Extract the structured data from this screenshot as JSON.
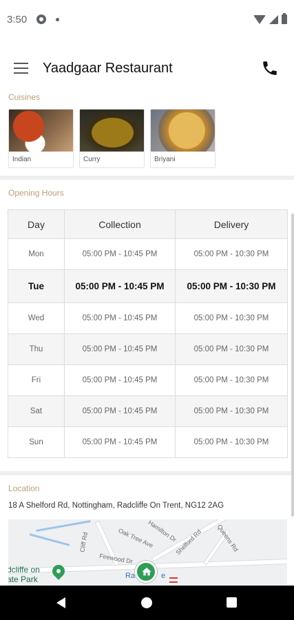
{
  "status_bar": {
    "time": "3:50"
  },
  "app_bar": {
    "title": "Yaadgaar Restaurant"
  },
  "cuisines": {
    "label": "Cuisines",
    "items": [
      {
        "name": "Indian"
      },
      {
        "name": "Curry"
      },
      {
        "name": "Briyani"
      }
    ]
  },
  "opening_hours": {
    "label": "Opening Hours",
    "headers": [
      "Day",
      "Collection",
      "Delivery"
    ],
    "rows": [
      {
        "day": "Mon",
        "collection": "05:00 PM - 10:45 PM",
        "delivery": "05:00 PM - 10:30 PM"
      },
      {
        "day": "Tue",
        "collection": "05:00 PM - 10:45 PM",
        "delivery": "05:00 PM - 10:30 PM",
        "today": true
      },
      {
        "day": "Wed",
        "collection": "05:00 PM - 10:45 PM",
        "delivery": "05:00 PM - 10:30 PM"
      },
      {
        "day": "Thu",
        "collection": "05:00 PM - 10:45 PM",
        "delivery": "05:00 PM - 10:30 PM"
      },
      {
        "day": "Fri",
        "collection": "05:00 PM - 10:45 PM",
        "delivery": "05:00 PM - 10:30 PM"
      },
      {
        "day": "Sat",
        "collection": "05:00 PM - 10:45 PM",
        "delivery": "05:00 PM - 10:30 PM"
      },
      {
        "day": "Sun",
        "collection": "05:00 PM - 10:45 PM",
        "delivery": "05:00 PM - 10:30 PM"
      }
    ]
  },
  "location": {
    "label": "Location",
    "address": "18 A Shelford Rd, Nottingham, Radcliffe On Trent, NG12 2AG",
    "map": {
      "street_labels": [
        "Oak Tree Ave",
        "Hamilton Dr",
        "Shelford Rd",
        "Queens Rd",
        "Firewood Dr",
        "Cliff Rd"
      ],
      "place_label_line1": "dcliffe on",
      "place_label_line2": "ate Park",
      "station_label": "Ra",
      "station_label_suffix": "e"
    }
  },
  "colors": {
    "section_label": "#b8a07a",
    "map_marker": "#2e9e57",
    "nav_bar": "#000000"
  },
  "icons": [
    "menu-icon",
    "phone-icon",
    "settings-icon",
    "wifi-icon",
    "signal-icon",
    "battery-icon",
    "location-pin-icon",
    "home-icon",
    "rail-icon",
    "back-icon",
    "home-nav-icon",
    "recents-icon"
  ]
}
